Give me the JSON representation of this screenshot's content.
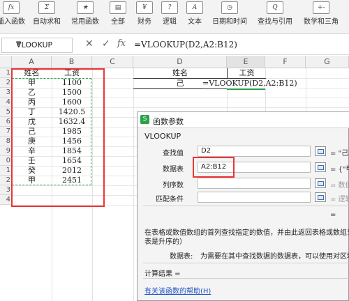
{
  "ribbon": {
    "buttons": [
      {
        "label": "插入函数",
        "icon": "fx"
      },
      {
        "label": "自动求和",
        "icon": "Σ"
      },
      {
        "label": "常用函数",
        "icon": "★"
      },
      {
        "label": "全部",
        "icon": "▤"
      },
      {
        "label": "财务",
        "icon": "¥"
      },
      {
        "label": "逻辑",
        "icon": "?"
      },
      {
        "label": "文本",
        "icon": "A"
      },
      {
        "label": "日期和时间",
        "icon": "◷"
      },
      {
        "label": "查找与引用",
        "icon": "Q"
      },
      {
        "label": "数学和三角",
        "icon": "+-"
      }
    ]
  },
  "formula_bar": {
    "name_box": "VLOOKUP",
    "fx": "fx",
    "formula": "=VLOOKUP(D2,A2:B12)"
  },
  "grid": {
    "columns": [
      "A",
      "B",
      "C",
      "D",
      "E",
      "F",
      "G"
    ],
    "rows": [
      "1",
      "2",
      "3",
      "4",
      "5",
      "6",
      "7",
      "8",
      "9",
      "0",
      "1",
      "2",
      "3",
      "4"
    ],
    "col_a": [
      "姓名",
      "甲",
      "乙",
      "丙",
      "丁",
      "戊",
      "己",
      "庚",
      "辛",
      "壬",
      "癸",
      "甲"
    ],
    "col_b": [
      "工资",
      "1100",
      "1500",
      "1600",
      "1420.5",
      "1632.4",
      "1985",
      "1456",
      "1854",
      "1654",
      "2012",
      "2451"
    ],
    "d1": "姓名",
    "e1": "工资",
    "d2": "己",
    "e2": "=VLOOKUP(D2,A2:B12)"
  },
  "dialog": {
    "title": "函数参数",
    "function_name": "VLOOKUP",
    "args": [
      {
        "label": "查找值",
        "value": "D2",
        "result": "= \"己"
      },
      {
        "label": "数据表",
        "value": "A2:B12",
        "result": "= {\"甲"
      },
      {
        "label": "列序数",
        "value": "",
        "result": "= 数值"
      },
      {
        "label": "匹配条件",
        "value": "",
        "result": "= 逻辑"
      }
    ],
    "result_eq": "=",
    "description": "在表格或数值数组的首列查找指定的数值，并由此返回表格或数组当前",
    "description2": "表是升序的）",
    "param_label": "数据表:",
    "param_desc": "为需要在其中查找数据的数据表，可以使用对区域",
    "calc_result_label": "计算结果 =",
    "help_link": "有关该函数的帮助(H)"
  }
}
